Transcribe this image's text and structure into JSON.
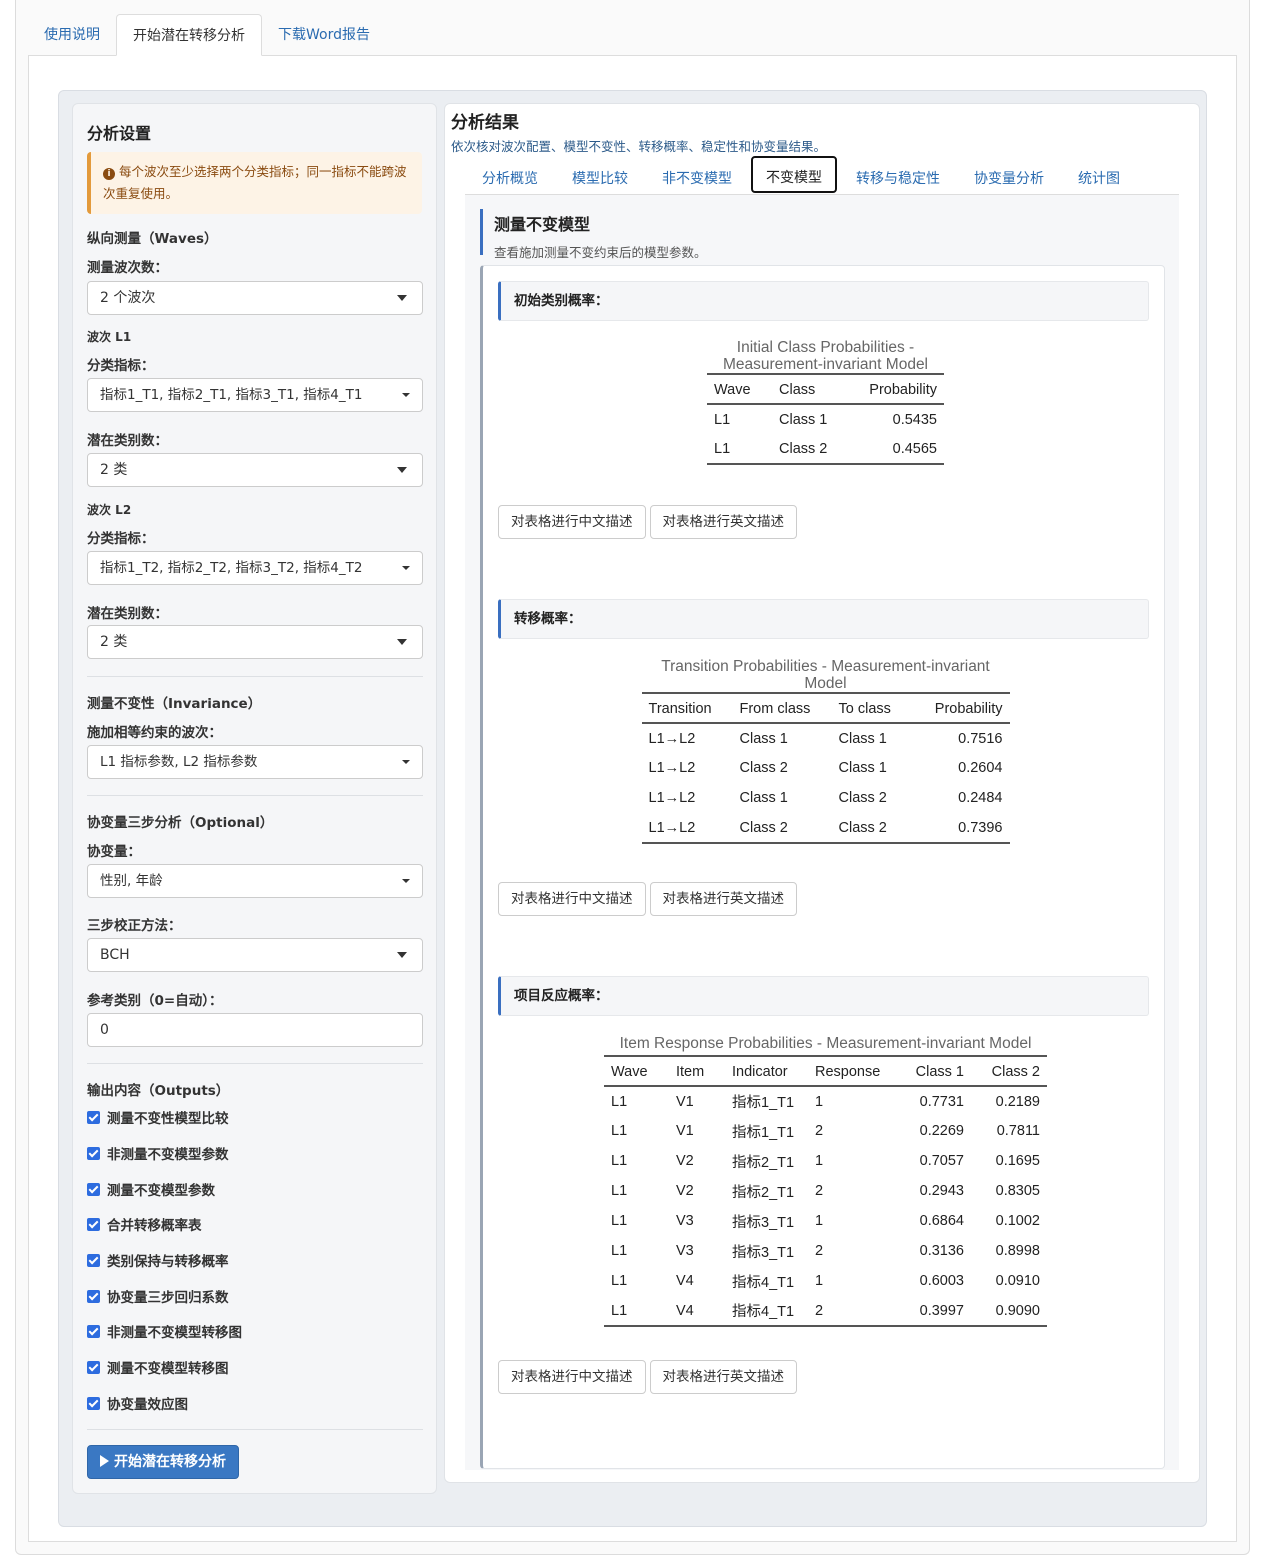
{
  "top_tabs": [
    "使用说明",
    "开始潜在转移分析",
    "下载Word报告"
  ],
  "sidebar": {
    "title": "分析设置",
    "alert": "每个波次至少选择两个分类指标；同一指标不能跨波次重复使用。",
    "waves_header": "纵向测量（Waves）",
    "num_waves_label": "测量波次数：",
    "num_waves_value": "2 个波次",
    "wave1_label": "波次 L1",
    "wave1_indicators_label": "分类指标：",
    "wave1_indicators_value": "指标1_T1, 指标2_T1, 指标3_T1, 指标4_T1",
    "wave1_classes_label": "潜在类别数：",
    "wave1_classes_value": "2 类",
    "wave2_label": "波次 L2",
    "wave2_indicators_label": "分类指标：",
    "wave2_indicators_value": "指标1_T2, 指标2_T2, 指标3_T2, 指标4_T2",
    "wave2_classes_label": "潜在类别数：",
    "wave2_classes_value": "2 类",
    "invariance_header": "测量不变性（Invariance）",
    "invariance_label": "施加相等约束的波次：",
    "invariance_value": "L1 指标参数, L2 指标参数",
    "covariate_header": "协变量三步分析（Optional）",
    "covariate_label": "协变量：",
    "covariate_value": "性别, 年龄",
    "method_label": "三步校正方法：",
    "method_value": "BCH",
    "ref_label": "参考类别（0=自动）：",
    "ref_value": "0",
    "outputs_header": "输出内容（Outputs）",
    "outputs": [
      "测量不变性模型比较",
      "非测量不变模型参数",
      "测量不变模型参数",
      "合并转移概率表",
      "类别保持与转移概率",
      "协变量三步回归系数",
      "非测量不变模型转移图",
      "测量不变模型转移图",
      "协变量效应图"
    ],
    "run_button": "开始潜在转移分析"
  },
  "main": {
    "title": "分析结果",
    "subtitle": "依次核对波次配置、模型不变性、转移概率、稳定性和协变量结果。",
    "tabs": [
      "分析概览",
      "模型比较",
      "非不变模型",
      "不变模型",
      "转移与稳定性",
      "协变量分析",
      "统计图"
    ],
    "section_title": "测量不变模型",
    "section_subtitle": "查看施加测量不变约束后的模型参数。",
    "btn_cn": "对表格进行中文描述",
    "btn_en": "对表格进行英文描述"
  },
  "tables": {
    "initial": {
      "caption_label": "初始类别概率：",
      "title_line1": "Initial Class Probabilities -",
      "title_line2": "Measurement-invariant Model",
      "headers": [
        "Wave",
        "Class",
        "Probability"
      ],
      "rows": [
        [
          "L1",
          "Class 1",
          "0.5435"
        ],
        [
          "L1",
          "Class 2",
          "0.4565"
        ]
      ]
    },
    "transition": {
      "caption_label": "转移概率：",
      "title_line1": "Transition Probabilities - Measurement-invariant",
      "title_line2": "Model",
      "headers": [
        "Transition",
        "From class",
        "To class",
        "Probability"
      ],
      "rows": [
        [
          "L1→L2",
          "Class 1",
          "Class 1",
          "0.7516"
        ],
        [
          "L1→L2",
          "Class 2",
          "Class 1",
          "0.2604"
        ],
        [
          "L1→L2",
          "Class 1",
          "Class 2",
          "0.2484"
        ],
        [
          "L1→L2",
          "Class 2",
          "Class 2",
          "0.7396"
        ]
      ]
    },
    "item": {
      "caption_label": "项目反应概率：",
      "title_line1": "Item Response Probabilities - Measurement-invariant Model",
      "headers": [
        "Wave",
        "Item",
        "Indicator",
        "Response",
        "Class 1",
        "Class 2"
      ],
      "rows": [
        [
          "L1",
          "V1",
          "指标1_T1",
          "1",
          "0.7731",
          "0.2189"
        ],
        [
          "L1",
          "V1",
          "指标1_T1",
          "2",
          "0.2269",
          "0.7811"
        ],
        [
          "L1",
          "V2",
          "指标2_T1",
          "1",
          "0.7057",
          "0.1695"
        ],
        [
          "L1",
          "V2",
          "指标2_T1",
          "2",
          "0.2943",
          "0.8305"
        ],
        [
          "L1",
          "V3",
          "指标3_T1",
          "1",
          "0.6864",
          "0.1002"
        ],
        [
          "L1",
          "V3",
          "指标3_T1",
          "2",
          "0.3136",
          "0.8998"
        ],
        [
          "L1",
          "V4",
          "指标4_T1",
          "1",
          "0.6003",
          "0.0910"
        ],
        [
          "L1",
          "V4",
          "指标4_T1",
          "2",
          "0.3997",
          "0.9090"
        ]
      ]
    }
  }
}
